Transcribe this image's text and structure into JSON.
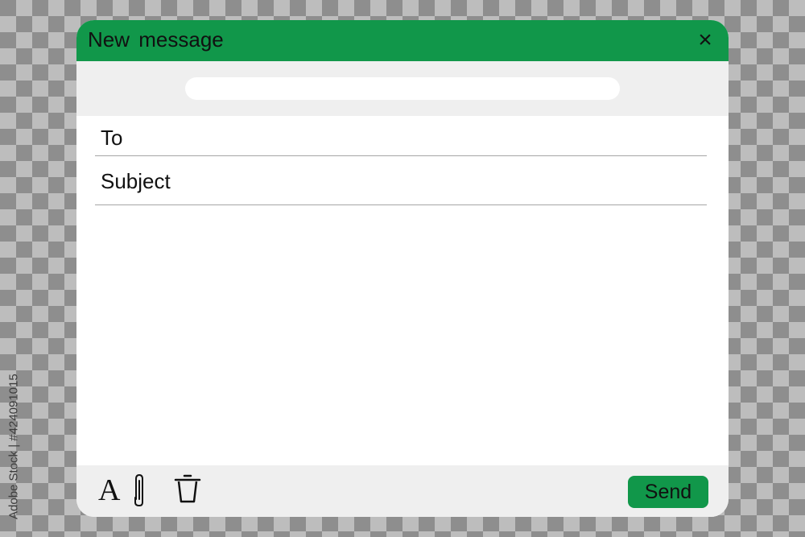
{
  "window": {
    "title": "New  message",
    "close_glyph": "×"
  },
  "search": {
    "value": "",
    "placeholder": ""
  },
  "fields": {
    "to_label": "To",
    "subject_label": "Subject"
  },
  "footer": {
    "font_glyph": "A",
    "send_label": "Send",
    "icons": [
      "text-format-icon",
      "paperclip-icon",
      "trash-icon"
    ]
  },
  "watermark": {
    "stock_id": "Adobe Stock | #424091015"
  },
  "colors": {
    "accent": "#11974a",
    "panel": "#efefef",
    "background_dark": "#8e8e8e",
    "background_light": "#bdbdbd"
  }
}
